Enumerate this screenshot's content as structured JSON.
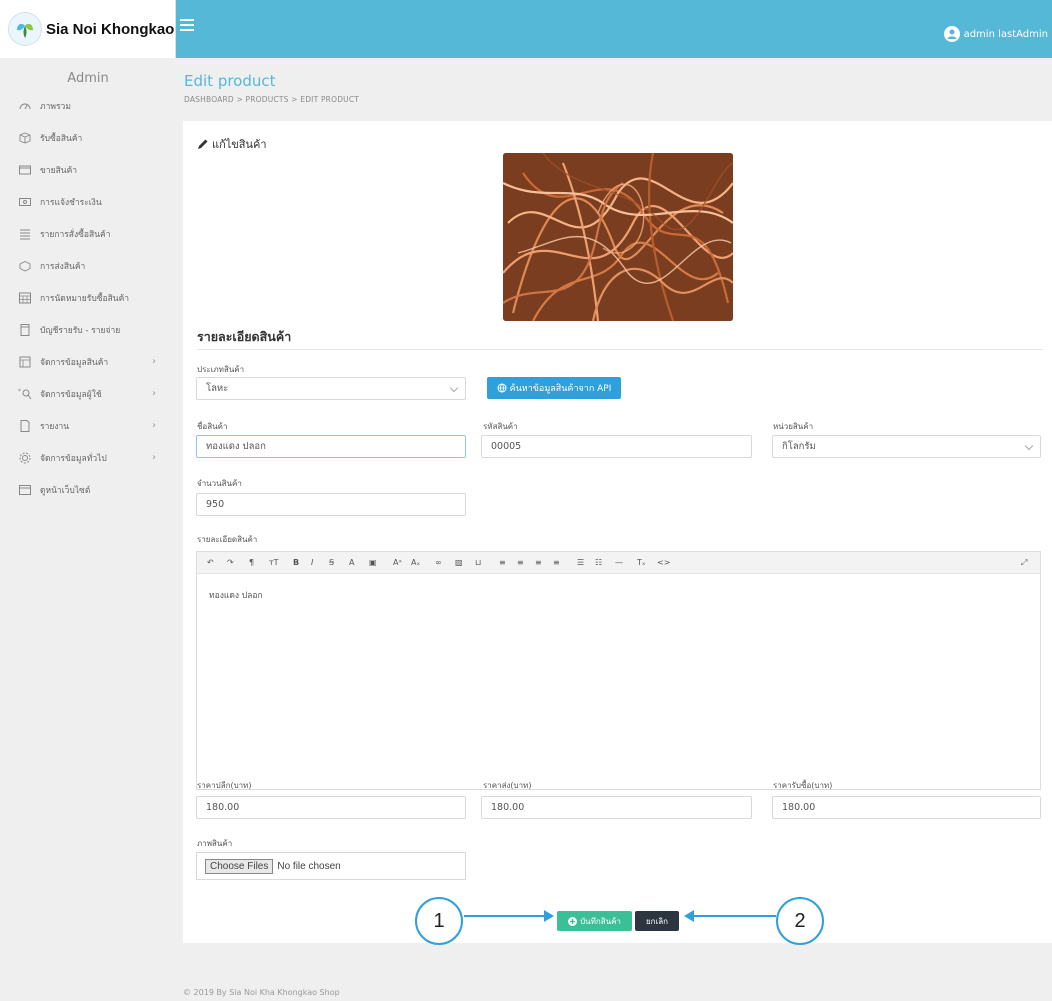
{
  "brand": {
    "name": "Sia Noi Khongkao"
  },
  "sidebar": {
    "role": "Admin",
    "items": [
      {
        "label": "ภาพรวม",
        "icon": "dashboard-icon",
        "chevron": false
      },
      {
        "label": "รับซื้อสินค้า",
        "icon": "box-icon",
        "chevron": false
      },
      {
        "label": "ขายสินค้า",
        "icon": "store-icon",
        "chevron": false
      },
      {
        "label": "การแจ้งชำระเงิน",
        "icon": "payment-icon",
        "chevron": false
      },
      {
        "label": "รายการสั่งซื้อสินค้า",
        "icon": "list-icon",
        "chevron": false
      },
      {
        "label": "การส่งสินค้า",
        "icon": "delivery-icon",
        "chevron": false
      },
      {
        "label": "การนัดหมายรับซื้อสินค้า",
        "icon": "calendar-icon",
        "chevron": false
      },
      {
        "label": "บัญชีรายรับ - รายจ่าย",
        "icon": "ledger-icon",
        "chevron": false
      },
      {
        "label": "จัดการข้อมูลสินค้า",
        "icon": "product-manage-icon",
        "chevron": true
      },
      {
        "label": "จัดการข้อมูลผู้ใช้",
        "icon": "user-manage-icon",
        "chevron": true
      },
      {
        "label": "รายงาน",
        "icon": "report-icon",
        "chevron": true
      },
      {
        "label": "จัดการข้อมูลทั่วไป",
        "icon": "settings-icon",
        "chevron": true
      },
      {
        "label": "ดูหน้าเว็บไซต์",
        "icon": "website-icon",
        "chevron": false
      }
    ]
  },
  "topbar": {
    "user": "admin lastAdmin"
  },
  "page": {
    "title": "Edit product",
    "breadcrumb": "DASHBOARD  >  PRODUCTS  >  EDIT PRODUCT"
  },
  "card": {
    "title": "แก้ไขสินค้า",
    "section_title": "รายละเอียดสินค้า"
  },
  "form": {
    "type_label": "ประเภทสินค้า",
    "type_value": "โลหะ",
    "api_button": "ค้นหาข้อมูลสินค้าจาก API",
    "name_label": "ชื่อสินค้า",
    "name_value": "ทองแดง ปลอก",
    "code_label": "รหัสสินค้า",
    "code_value": "00005",
    "unit_label": "หน่วยสินค้า",
    "unit_value": "กิโลกรัม",
    "qty_label": "จำนวนสินค้า",
    "qty_value": "950",
    "detail_label": "รายละเอียดสินค้า",
    "detail_value": "ทองแดง ปลอก",
    "retail_label": "ราคาปลีก(บาท)",
    "retail_value": "180.00",
    "wholesale_label": "ราคาส่ง(บาท)",
    "wholesale_value": "180.00",
    "buy_label": "ราคารับซื้อ(บาท)",
    "buy_value": "180.00",
    "image_label": "ภาพสินค้า",
    "choose_files": "Choose Files",
    "no_file": "No file chosen",
    "save_button": "บันทึกสินค้า",
    "cancel_button": "ยกเลิก"
  },
  "callouts": {
    "one": "1",
    "two": "2"
  },
  "footer": "© 2019 By Sia Noi Kha Khongkao Shop",
  "colors": {
    "accent": "#55b8d6",
    "save": "#3bbf97",
    "cancel": "#2d3640",
    "api": "#2fa0db"
  }
}
